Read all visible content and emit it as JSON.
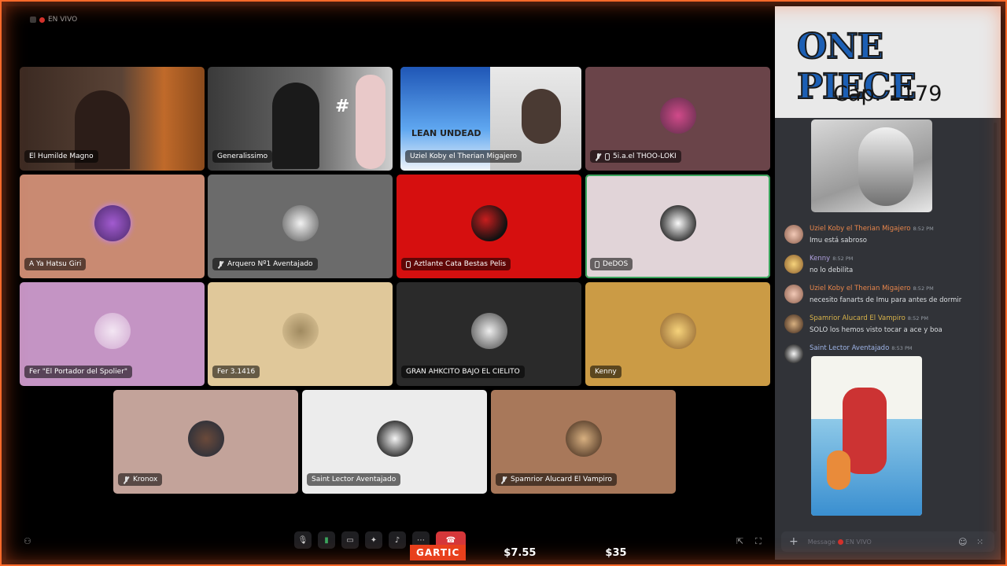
{
  "status": {
    "live_label": "EN VIVO"
  },
  "participants": [
    {
      "name": "El Humilde Magno",
      "icon": "none",
      "bg": "#3b2a22"
    },
    {
      "name": "Generalissimo",
      "icon": "none",
      "bg": "#4b4b4b"
    },
    {
      "name": "Uziel Koby el Therian Migajero",
      "icon": "none",
      "bg": "#5d6b86"
    },
    {
      "name": "5i.a.el THOO-LOKI",
      "icon": "mic-off-icon",
      "bg": "#6a4449"
    },
    {
      "name": "A Ya Hatsu Giri",
      "icon": "none",
      "bg": "#c98a72"
    },
    {
      "name": "Arquero Nº1 Aventajado",
      "icon": "mic-off-icon",
      "bg": "#6b6b6b"
    },
    {
      "name": "Aztlante Cata Bestas Pelis",
      "icon": "phone-icon",
      "bg": "#d60f0f"
    },
    {
      "name": "DeDOS",
      "icon": "phone-icon",
      "bg": "#e1d4d8"
    },
    {
      "name": "Fer \"El Portador del Spolier\"",
      "icon": "none",
      "bg": "#c494c4"
    },
    {
      "name": "Fer 3.1416",
      "icon": "none",
      "bg": "#e0c89a"
    },
    {
      "name": "GRAN AHKCITO BAJO EL CIELITO",
      "icon": "none",
      "bg": "#2a2a2a"
    },
    {
      "name": "Kenny",
      "icon": "none",
      "bg": "#cb9b45"
    },
    {
      "name": "Kronox",
      "icon": "mic-off-icon",
      "bg": "#c3a39a"
    },
    {
      "name": "Saint Lector Aventajado",
      "icon": "none",
      "bg": "#ececec"
    },
    {
      "name": "Spamrior Alucard El Vampiro",
      "icon": "mic-off-icon",
      "bg": "#a8785a"
    }
  ],
  "video_texts": {
    "cover_text": "LEAN UNDEAD",
    "overlay_text": "#"
  },
  "controls": {
    "mic": "microphone-icon",
    "camera": "camera-icon",
    "screen": "share-screen-icon",
    "activities": "activities-icon",
    "soundboard": "soundboard-icon",
    "more": "more-icon",
    "leave": "leave-call-icon"
  },
  "ticker": {
    "tag": "GARTIC",
    "price1": "$7.55",
    "price2": "$35"
  },
  "banner": {
    "logo": "ONE PIECE",
    "chapter": "Cap. 1179"
  },
  "chat": {
    "messages": [
      {
        "author": "Uziel Koby el Therian Migajero",
        "time": "8:52 PM",
        "text": "Imu está sabroso",
        "color": "#e9864b"
      },
      {
        "author": "Kenny",
        "time": "8:52 PM",
        "text": "no lo debilita",
        "color": "#b0a1e0"
      },
      {
        "author": "Uziel Koby el Therian Migajero",
        "time": "8:52 PM",
        "text": "necesito fanarts de Imu para antes de dormir",
        "color": "#e9864b"
      },
      {
        "author": "Spamrior Alucard El Vampiro",
        "time": "8:52 PM",
        "text": "SOLO los hemos visto tocar a ace y boa",
        "color": "#d9b44a"
      },
      {
        "author": "Saint Lector Aventajado",
        "time": "8:53 PM",
        "text": "",
        "color": "#9fb5e8"
      }
    ],
    "composer": {
      "placeholder": "Message",
      "live": "EN VIVO"
    }
  }
}
